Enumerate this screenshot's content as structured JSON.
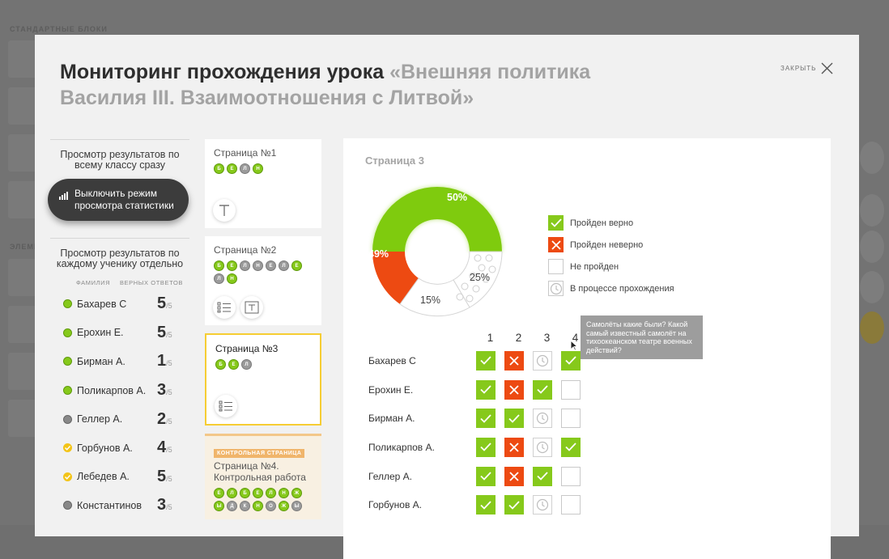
{
  "background": {
    "section_standard": "СТАНДАРТНЫЕ БЛОКИ",
    "section_elements": "ЭЛЕМЕ"
  },
  "modal": {
    "title_main": "Мониторинг прохождения урока ",
    "title_lesson": "«Внешняя политика Василия III. Взаимоотношения с Литвой»",
    "close_label": "ЗАКРЫТЬ"
  },
  "left": {
    "class_heading": "Просмотр результатов по всему классу сразу",
    "toggle_label": "Выключить режим просмотра статистики",
    "student_heading": "Просмотр результатов по каждому ученику отдельно",
    "col_surname": "ФАМИЛИЯ",
    "col_correct": "ВЕРНЫХ ОТВЕТОВ",
    "score_total": "/5",
    "students": [
      {
        "name": "Бахарев С",
        "score": "5",
        "status": "green"
      },
      {
        "name": "Ерохин Е.",
        "score": "5",
        "status": "green"
      },
      {
        "name": "Бирман А.",
        "score": "1",
        "status": "green"
      },
      {
        "name": "Поликарпов А.",
        "score": "3",
        "status": "green"
      },
      {
        "name": "Геллер А.",
        "score": "2",
        "status": "gray"
      },
      {
        "name": "Горбунов А.",
        "score": "4",
        "status": "yellow"
      },
      {
        "name": "Лебедев А.",
        "score": "5",
        "status": "yellow"
      },
      {
        "name": "Константинов",
        "score": "3",
        "status": "gray"
      }
    ]
  },
  "pages": [
    {
      "title": "Страница №1",
      "chips": [
        {
          "l": "Б",
          "c": "g"
        },
        {
          "l": "Е",
          "c": "g"
        },
        {
          "l": "Л",
          "c": "n"
        },
        {
          "l": "Н",
          "c": "g"
        }
      ],
      "icons": [
        "text-icon"
      ]
    },
    {
      "title": "Страница №2",
      "chips": [
        {
          "l": "Б",
          "c": "g"
        },
        {
          "l": "Е",
          "c": "g"
        },
        {
          "l": "Л",
          "c": "n"
        },
        {
          "l": "Н",
          "c": "n"
        },
        {
          "l": "Е",
          "c": "n"
        },
        {
          "l": "Л",
          "c": "n"
        },
        {
          "l": "Е",
          "c": "g"
        },
        {
          "l": "Л",
          "c": "n"
        },
        {
          "l": "Н",
          "c": "g"
        }
      ],
      "icons": [
        "list-icon",
        "text-box-icon"
      ]
    },
    {
      "title": "Страница №3",
      "chips": [
        {
          "l": "Б",
          "c": "g"
        },
        {
          "l": "Е",
          "c": "g"
        },
        {
          "l": "Л",
          "c": "n"
        }
      ],
      "icons": [
        "list-icon"
      ]
    },
    {
      "badge": "КОНТРОЛЬНАЯ СТРАНИЦА",
      "title": "Страница №4. Контрольная работа",
      "chips": [
        {
          "l": "Е",
          "c": "g"
        },
        {
          "l": "Л",
          "c": "g"
        },
        {
          "l": "Б",
          "c": "g"
        },
        {
          "l": "Е",
          "c": "g"
        },
        {
          "l": "Л",
          "c": "g"
        },
        {
          "l": "Н",
          "c": "g"
        },
        {
          "l": "Ж",
          "c": "g"
        },
        {
          "l": "Ы",
          "c": "g"
        },
        {
          "l": "Д",
          "c": "n"
        },
        {
          "l": "К",
          "c": "n"
        },
        {
          "l": "Н",
          "c": "g"
        },
        {
          "l": "О",
          "c": "n"
        },
        {
          "l": "Ж",
          "c": "g"
        },
        {
          "l": "Ы",
          "c": "n"
        }
      ],
      "icons": []
    }
  ],
  "panel": {
    "title": "Страница 3",
    "chart_data": {
      "type": "pie",
      "style": "donut",
      "values": [
        {
          "label": "50%",
          "value": 50,
          "color": "#7fcb0e"
        },
        {
          "label": "25%",
          "value": 25,
          "color": "#ffffff"
        },
        {
          "label": "15%",
          "value": 15,
          "color": "#ffffff"
        },
        {
          "label": "49%",
          "value": 49,
          "color": "#ed4a12"
        }
      ]
    },
    "legend": [
      {
        "label": "Пройден верно",
        "type": "green"
      },
      {
        "label": "Пройден неверно",
        "type": "red"
      },
      {
        "label": "Не пройден",
        "type": "empty"
      },
      {
        "label": "В процессе прохождения",
        "type": "clock"
      }
    ],
    "questions": [
      "1",
      "2",
      "3",
      "4"
    ],
    "results": [
      {
        "name": "Бахарев С",
        "answers": [
          "green",
          "red",
          "clock",
          "green"
        ]
      },
      {
        "name": "Ерохин Е.",
        "answers": [
          "green",
          "red",
          "green",
          "empty"
        ]
      },
      {
        "name": "Бирман А.",
        "answers": [
          "green",
          "green",
          "clock",
          "empty"
        ]
      },
      {
        "name": "Поликарпов А.",
        "answers": [
          "green",
          "red",
          "clock",
          "green"
        ]
      },
      {
        "name": "Геллер А.",
        "answers": [
          "green",
          "red",
          "green",
          "empty"
        ]
      },
      {
        "name": "Горбунов А.",
        "answers": [
          "green",
          "green",
          "clock",
          "empty"
        ]
      }
    ],
    "tooltip": "Самолёты какие были? Какой самый известный самолёт на тихоокеанском театре военных действий?"
  },
  "colors": {
    "green": "#86c91b",
    "red": "#ed4a12",
    "accent_yellow": "#f6cd33",
    "control_orange": "#f0b56b"
  }
}
